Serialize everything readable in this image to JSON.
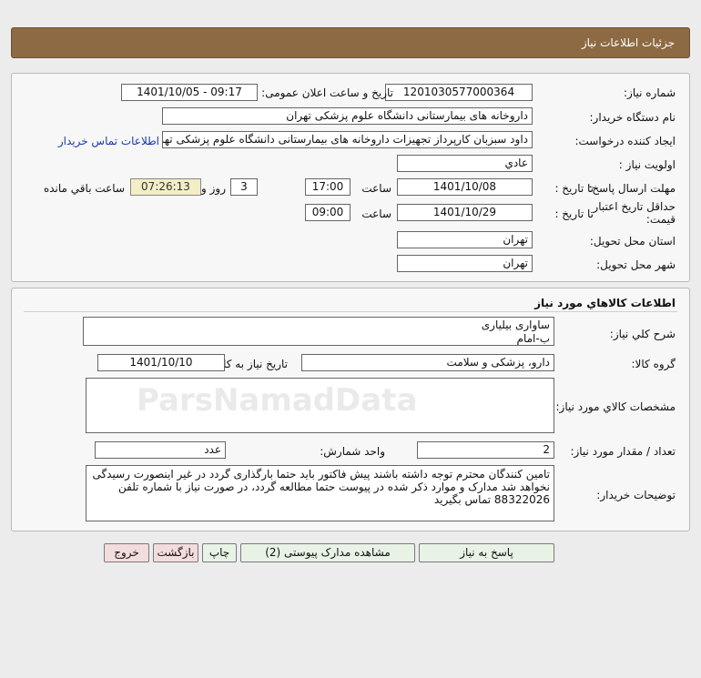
{
  "header": {
    "title": "جزئیات اطلاعات نیاز"
  },
  "info": {
    "need_number_label": "شماره نیاز:",
    "need_number": "1201030577000364",
    "announce_label": "تاریخ و ساعت اعلان عمومی:",
    "announce_value": "1401/10/05 - 09:17",
    "buyer_org_label": "نام دستگاه خریدار:",
    "buyer_org": "داروخانه های بیمارستانی دانشگاه علوم پزشکی تهران",
    "requester_label": "ایجاد کننده درخواست:",
    "requester": "داود سبزبان کارپرداز تجهیزات داروخانه های بیمارستانی دانشگاه علوم پزشکی تهران",
    "contact_link": "اطلاعات تماس خریدار",
    "priority_label": "اولویت نیاز :",
    "priority": "عادي",
    "reply_deadline_label": "مهلت ارسال پاسخ:",
    "to_date_label": "تا تاریخ :",
    "reply_date": "1401/10/08",
    "time_label": "ساعت",
    "reply_time": "17:00",
    "days": "3",
    "days_suffix": "روز و",
    "remaining_time": "07:26:13",
    "remaining_label": "ساعت باقي مانده",
    "validity_label": "حداقل تاریخ اعتبار قیمت:",
    "validity_date": "1401/10/29",
    "validity_time": "09:00",
    "province_label": "استان محل تحویل:",
    "province": "تهران",
    "city_label": "شهر محل تحویل:",
    "city": "تهران"
  },
  "goods": {
    "section_title": "اطلاعات کالاهاي مورد نياز",
    "summary_label": "شرح كلي نياز:",
    "summary_line1": "ساوارى بيليارى",
    "summary_line2": "ب-امام",
    "group_label": "گروه کالا:",
    "group": "دارو، پزشکی و سلامت",
    "need_date_label": "تاریخ نیاز به کالا:",
    "need_date": "1401/10/10",
    "specs_label": "مشخصات كالاي مورد نياز:",
    "specs": "",
    "qty_label": "تعداد / مقدار مورد نیاز:",
    "qty": "2",
    "unit_label": "واحد شمارش:",
    "unit": "عدد",
    "notes_label": "توضیحات خریدار:",
    "notes": "تامین کنندگان محترم توجه داشته باشند پیش فاکتور باید حتما بارگذاری گردد در غیر اینصورت رسیدگی نخواهد شد مدارک و موارد ذکر شده در پیوست حتما مطالعه گردد، در صورت نیاز با شماره تلفن 88322026 تماس بگیرید"
  },
  "buttons": {
    "reply": "پاسخ به نیاز",
    "attachments": "مشاهده مدارک پیوستی (2)",
    "print": "چاپ",
    "back": "بازگشت",
    "exit": "خروج"
  },
  "colors": {
    "header_bg": "#8d6a43",
    "button_green": "#e8f3e6",
    "button_pink": "#f3dcdc",
    "timer_bg": "#f3eec6",
    "link": "#1a3aa8"
  }
}
